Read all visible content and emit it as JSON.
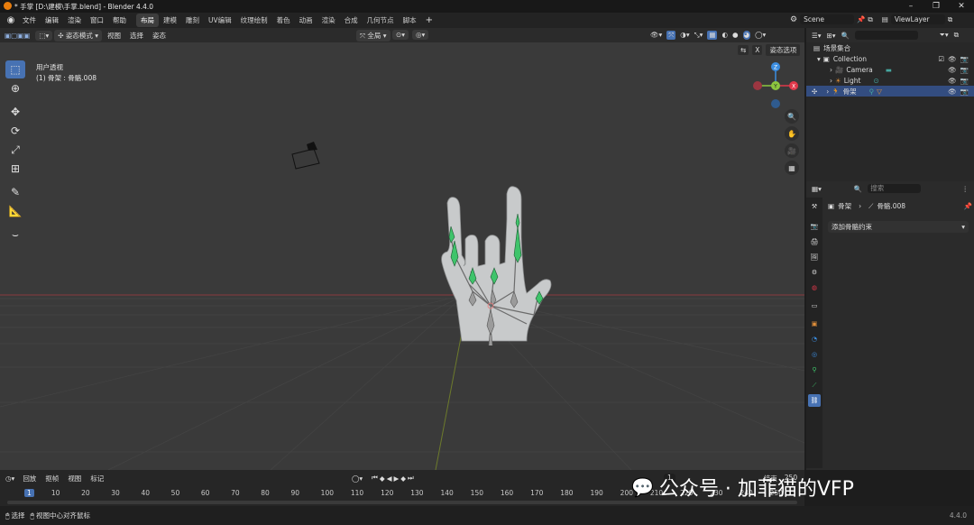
{
  "window": {
    "title": "* 手掌 [D:\\建模\\手掌.blend] - Blender 4.4.0"
  },
  "menus": [
    "文件",
    "编辑",
    "渲染",
    "窗口",
    "帮助"
  ],
  "workspaces": [
    {
      "label": "布局",
      "active": true
    },
    {
      "label": "建模"
    },
    {
      "label": "雕刻"
    },
    {
      "label": "UV编辑"
    },
    {
      "label": "纹理绘制"
    },
    {
      "label": "着色"
    },
    {
      "label": "动画"
    },
    {
      "label": "渲染"
    },
    {
      "label": "合成"
    },
    {
      "label": "几何节点"
    },
    {
      "label": "脚本"
    }
  ],
  "scene": {
    "name": "Scene",
    "view_layer": "ViewLayer"
  },
  "viewport": {
    "mode": "姿态模式",
    "menus": [
      "视图",
      "选择",
      "姿态"
    ],
    "transform_orientation": "全局",
    "view_name": "用户透视",
    "selection_info": "(1) 骨架 : 骨骼.008",
    "pose_options": "姿态选项",
    "x_toggle": "X"
  },
  "gizmo": {
    "x": "X",
    "y": "Y",
    "z": "Z"
  },
  "outliner": {
    "search_placeholder": "",
    "root": "场景集合",
    "collection": "Collection",
    "items": [
      {
        "name": "Camera"
      },
      {
        "name": "Light"
      },
      {
        "name": "骨架"
      }
    ]
  },
  "properties": {
    "breadcrumb_object": "骨架",
    "breadcrumb_bone": "骨骼.008",
    "add_constraint": "添加骨骼约束",
    "search_placeholder": "搜索"
  },
  "timeline": {
    "menus": [
      "回放",
      "抠帧",
      "视图",
      "标记"
    ],
    "current_frame": "1",
    "start_frame": "1",
    "end_label": "结束",
    "end_frame": "250",
    "ticks": [
      "1",
      "10",
      "20",
      "30",
      "40",
      "50",
      "60",
      "70",
      "80",
      "90",
      "100",
      "110",
      "120",
      "130",
      "140",
      "150",
      "160",
      "170",
      "180",
      "190",
      "200",
      "210",
      "220",
      "230",
      "240",
      "250"
    ]
  },
  "status": {
    "select": "选择",
    "center": "视图中心对齐鼠标",
    "version": "4.4.0"
  },
  "watermark": "公众号 · 加菲猫的VFP",
  "colors": {
    "accent": "#4772b3",
    "bone_green": "#3fc46b",
    "x_axis": "#e0384a",
    "y_axis": "#8cc63f",
    "z_axis": "#3b8de0"
  }
}
